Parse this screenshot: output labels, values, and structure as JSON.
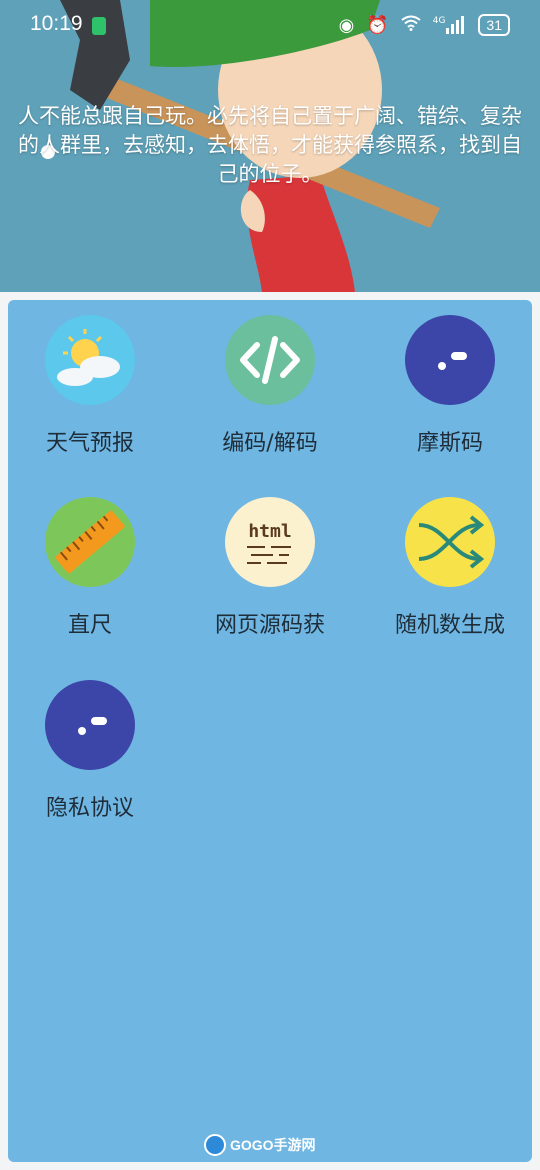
{
  "status_bar": {
    "time": "10:19",
    "network": "4G",
    "battery": "31"
  },
  "header": {
    "quote": "人不能总跟自己玩。必先将自己置于广阔、错综、复杂的人群里，去感知，去体悟，才能获得参照系，找到自己的位子。"
  },
  "tools": [
    {
      "label": "天气预报",
      "icon": "weather-icon",
      "color": "#5cc8ec"
    },
    {
      "label": "编码/解码",
      "icon": "code-icon",
      "color": "#6bbf9d"
    },
    {
      "label": "摩斯码",
      "icon": "morse-icon",
      "color": "#3b46a8"
    },
    {
      "label": "直尺",
      "icon": "ruler-icon",
      "color": "#7dc75a"
    },
    {
      "label": "网页源码获",
      "icon": "html-icon",
      "color": "#fbf1cf"
    },
    {
      "label": "随机数生成",
      "icon": "shuffle-icon",
      "color": "#f7e24a"
    },
    {
      "label": "隐私协议",
      "icon": "privacy-icon",
      "color": "#3b46a8"
    }
  ],
  "watermark": {
    "text": "GOGO手游网"
  },
  "colors": {
    "header_bg": "#5fa1b8",
    "panel_bg": "#6fb6e2",
    "label_text": "#1f2d3a"
  }
}
